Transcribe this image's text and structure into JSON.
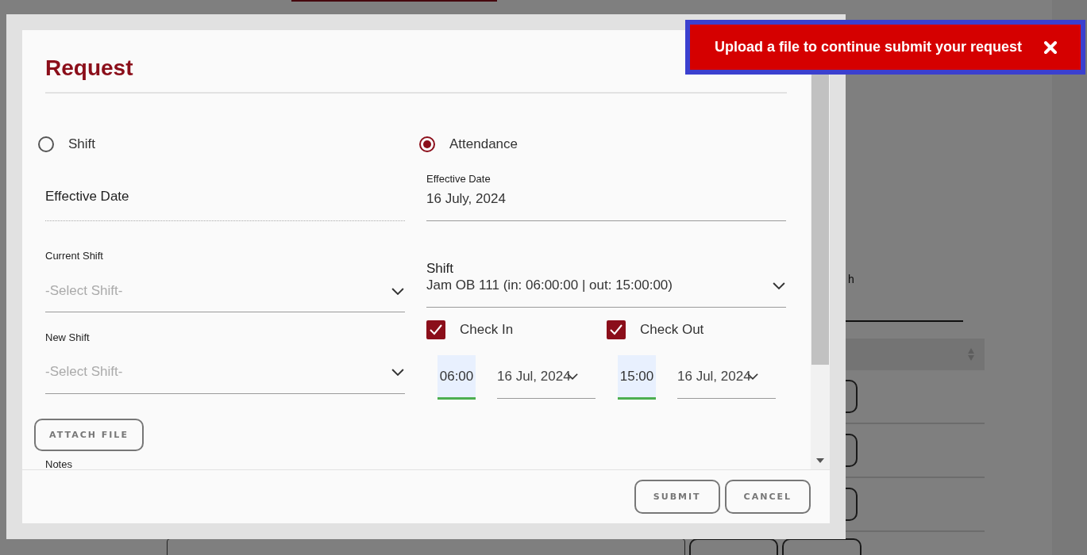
{
  "background": {
    "label_fragment": "h"
  },
  "dialog": {
    "title": "Request",
    "options": [
      {
        "label": "Shift",
        "selected": false
      },
      {
        "label": "Attendance",
        "selected": true
      }
    ],
    "shift_form": {
      "effective_date": {
        "placeholder": "Effective Date"
      },
      "current_shift": {
        "label": "Current Shift",
        "placeholder": "-Select Shift-"
      },
      "new_shift": {
        "label": "New Shift",
        "placeholder": "-Select Shift-"
      },
      "attach_button": "ATTACH FILE",
      "notes_label": "Notes"
    },
    "attendance_form": {
      "effective_date": {
        "label": "Effective Date",
        "value": "16 July, 2024"
      },
      "shift": {
        "label": "Shift",
        "value": "Jam OB 111 (in: 06:00:00 | out: 15:00:00)"
      },
      "checks": [
        {
          "label": "Check In",
          "checked": true,
          "time": "06:00",
          "date": "16 Jul, 2024"
        },
        {
          "label": "Check Out",
          "checked": true,
          "time": "15:00",
          "date": "16 Jul, 2024"
        }
      ]
    },
    "buttons": [
      "SUBMIT",
      "CANCEL"
    ]
  },
  "toast": {
    "message": "Upload a file to continue submit your request"
  }
}
